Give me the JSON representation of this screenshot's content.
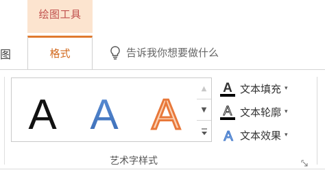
{
  "context_tab": {
    "title": "绘图工具"
  },
  "tabs": {
    "partial_prev": "图",
    "active": "格式"
  },
  "tell_me": {
    "text": "告诉我你想要做什么"
  },
  "wordart_gallery": {
    "items": [
      {
        "glyph": "A",
        "style": "black-fill"
      },
      {
        "glyph": "A",
        "style": "blue-fill"
      },
      {
        "glyph": "A",
        "style": "orange-outline"
      }
    ],
    "scroll_up": "▲",
    "scroll_down": "▼",
    "more": "▾"
  },
  "commands": {
    "fill_label": "文本填充",
    "outline_label": "文本轮廓",
    "effects_label": "文本效果",
    "dropdown_glyph": "▾"
  },
  "group": {
    "label": "艺术字样式"
  },
  "colors": {
    "accent_orange": "#e07a2f",
    "context_bg": "#fce4cf",
    "wordart_blue": "#4a7cc7",
    "wordart_orange": "#f08a4b"
  }
}
